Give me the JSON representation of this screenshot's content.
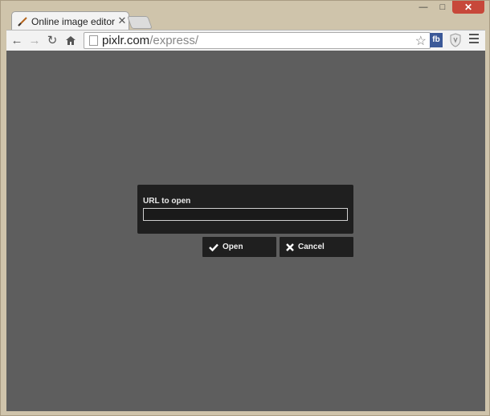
{
  "browser": {
    "tab_title": "Online image editor pixlr",
    "url_host": "pixlr.com",
    "url_path": "/express/",
    "extension_label": "fb"
  },
  "dialog": {
    "label": "URL to open",
    "input_value": "",
    "input_placeholder": "",
    "open_label": "Open",
    "cancel_label": "Cancel"
  },
  "colors": {
    "workspace": "#5e5e5e",
    "dialog_bg": "#1f1f1f",
    "window_frame": "#cfc4ab"
  }
}
